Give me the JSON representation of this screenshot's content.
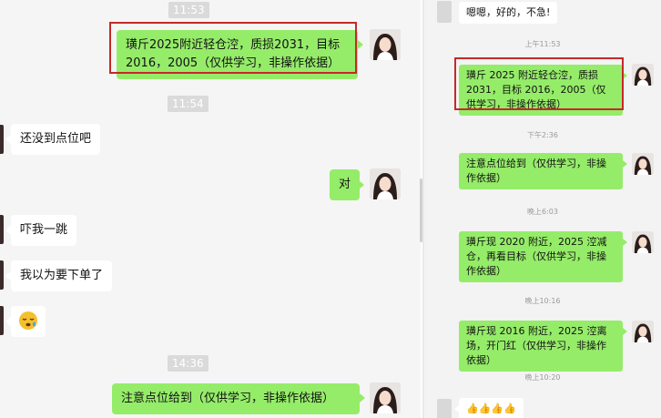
{
  "left_chat": {
    "timestamps": [
      "11:53",
      "11:54",
      "14:36"
    ],
    "messages": {
      "m1": "璜斤2025附近轻仓涳，质损2031，目标2016，2005（仅供学习，非操作依据）",
      "m2": "还没到点位吧",
      "m3": "对",
      "m4": "吓我一跳",
      "m5": "我以为要下单了",
      "m6": "😪",
      "m7": "注意点位给到（仅供学习，非操作依据）"
    }
  },
  "right_chat": {
    "timestamps": [
      "上午11:53",
      "下午2:36",
      "晚上6:03",
      "晚上10:16",
      "晚上10:20"
    ],
    "messages": {
      "r0": "嗯嗯，好的，不急!",
      "r1": "璜斤 2025 附近轻仓涳，质损 2031，目标 2016，2005（仅供学习，非操作依据）",
      "r2": "注意点位给到（仅供学习，非操作依据）",
      "r3": "璜斤现 2020 附近，2025 涳减仓，再看目标（仅供学习，非操作依据）",
      "r4": "璜斤现 2016 附近，2025 涳离场，开门红（仅供学习，非操作依据）",
      "r5": "👍👍👍👍"
    }
  },
  "colors": {
    "sent_bubble": "#95ec69",
    "received_bubble": "#ffffff",
    "highlight_box": "#c62828",
    "chat_background": "#f5f5f5"
  }
}
